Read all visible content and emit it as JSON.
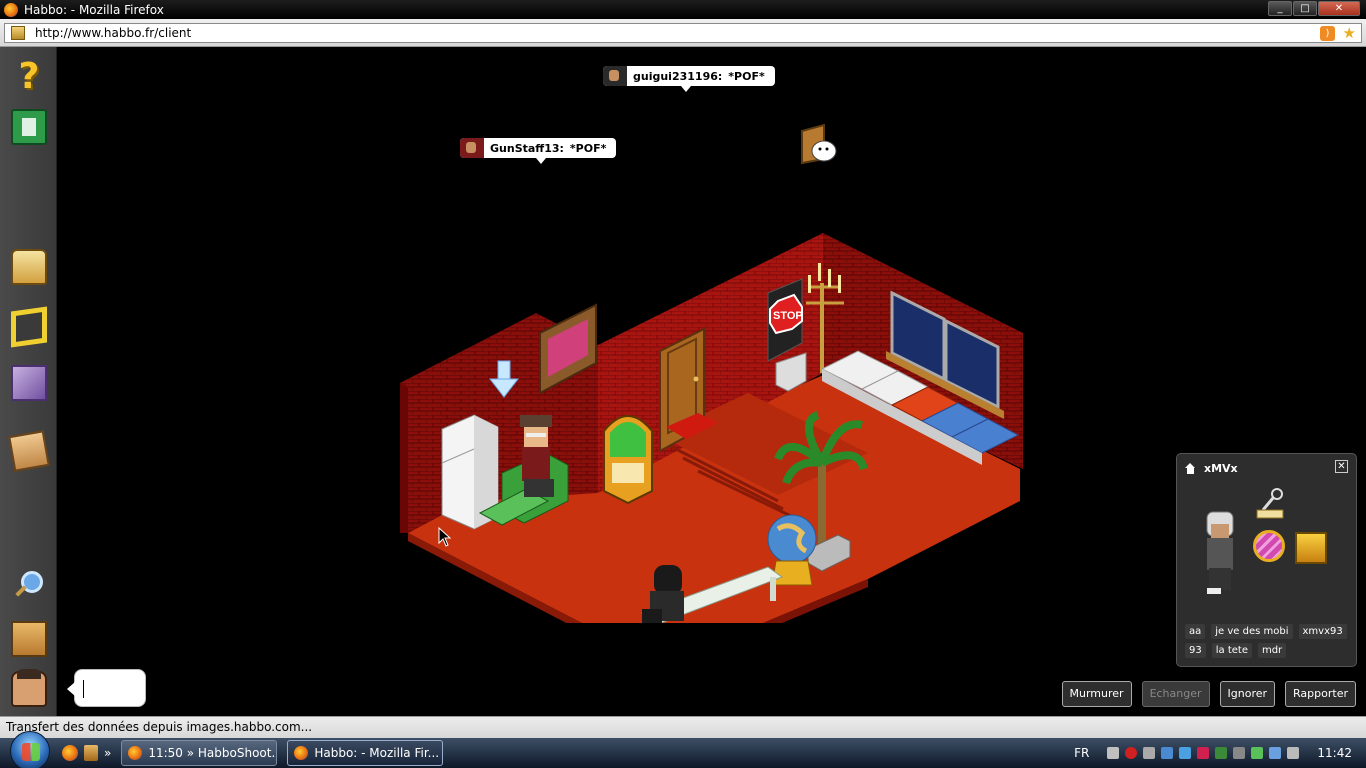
{
  "window": {
    "title": "Habbo: - Mozilla Firefox",
    "controls": [
      "_",
      "□",
      "✕"
    ]
  },
  "browser": {
    "url": "http://www.habbo.fr/client",
    "status_text": "Transfert des données depuis images.habbo.com..."
  },
  "toolbar": {
    "help_glyph": "?"
  },
  "chat_bubbles": [
    {
      "name": "guigui231196:",
      "text": "*POF*"
    },
    {
      "name": "GunStaff13:",
      "text": "*POF*"
    }
  ],
  "user_panel": {
    "username": "xMVx",
    "close_glyph": "✕",
    "tags": [
      "aa",
      "je ve des mobi",
      "xmvx93",
      "93",
      "la tete",
      "mdr"
    ]
  },
  "actions": {
    "whisper": "Murmurer",
    "trade": "Echanger",
    "ignore": "Ignorer",
    "report": "Rapporter"
  },
  "taskbar": {
    "quick_more": "»",
    "tasks": [
      "11:50 » HabboShoot...",
      "Habbo: - Mozilla Fir..."
    ],
    "language": "FR",
    "clock": "11:42"
  },
  "colors": {
    "floor": "#c8320f",
    "wall": "#a8140f",
    "panel_bg": "#2d2d2d"
  }
}
